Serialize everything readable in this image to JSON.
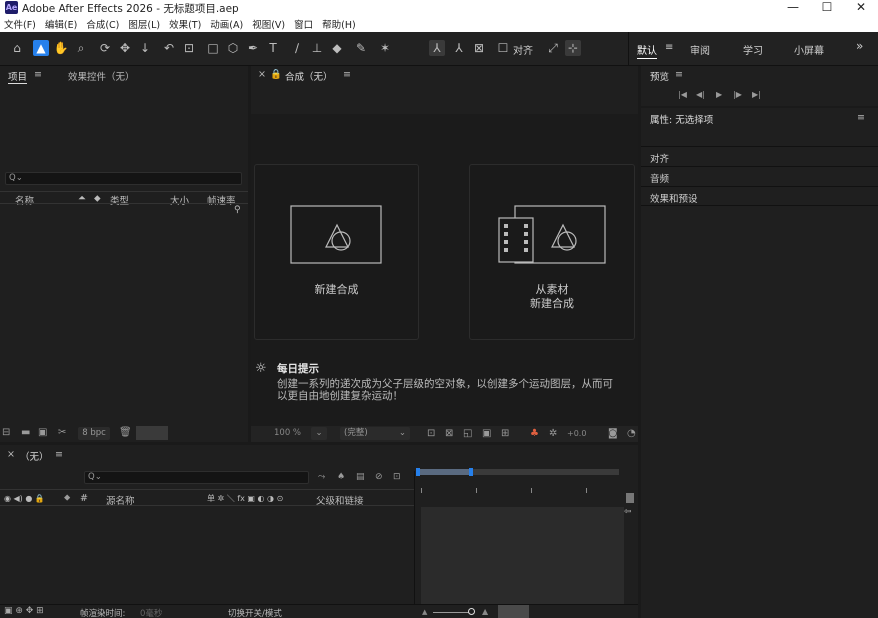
{
  "app": {
    "logo": "Ae",
    "title": "Adobe After Effects 2026 - 无标题项目.aep",
    "minimize": "—",
    "maximize": "☐",
    "close": "✕"
  },
  "menu": [
    "文件(F)",
    "编辑(E)",
    "合成(C)",
    "图层(L)",
    "效果(T)",
    "动画(A)",
    "视图(V)",
    "窗口",
    "帮助(H)"
  ],
  "toolbar": {
    "align_label": "对齐"
  },
  "workspaces": {
    "default": "默认",
    "review": "审阅",
    "learn": "学习",
    "small": "小屏幕",
    "more": "»",
    "menu": "≡"
  },
  "project": {
    "tab_project": "项目",
    "tab_effects": "效果控件（无）",
    "menu": "≡",
    "search_placeholder": "Q⌄",
    "col_name": "名称",
    "col_type": "类型",
    "col_size": "大小",
    "col_fps": "帧速率",
    "bpc": "8 bpc"
  },
  "comp": {
    "close": "×",
    "tab": "合成（无）",
    "menu": "≡",
    "new_comp": "新建合成",
    "from_footage_line1": "从素材",
    "from_footage_line2": "新建合成",
    "tip_title": "每日提示",
    "tip_line1": "创建一系列的递次成为父子层级的空对象，以创建多个运动图层，从而可",
    "tip_line2": "以更自由地创建复杂运动！",
    "zoom": "100 %",
    "resolution": "(完整)",
    "exposure": "+0.0"
  },
  "timeline": {
    "close": "×",
    "tab": "（无）",
    "menu": "≡",
    "search_placeholder": "Q⌄",
    "col_source": "源名称",
    "col_switches": "单 ✲ ＼ fx ▣ ◐ ◑ ⊙",
    "col_parent": "父级和链接",
    "hash": "#",
    "render_time_label": "帧渲染时间:",
    "render_time_value": "0毫秒",
    "toggle_label": "切换开关/模式"
  },
  "right": {
    "preview_title": "预览",
    "preview_menu": "≡",
    "properties_title": "属性: 无选择项",
    "properties_menu": "≡",
    "align": "对齐",
    "audio": "音频",
    "effects_presets": "效果和预设"
  }
}
